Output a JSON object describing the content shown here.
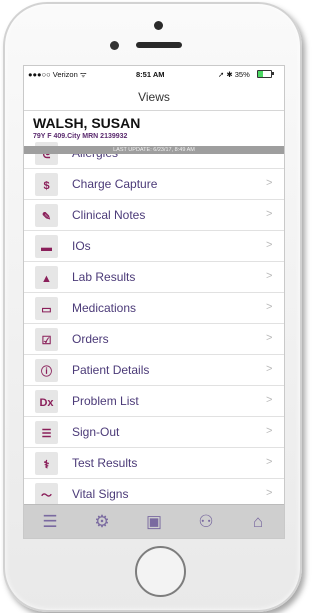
{
  "status_bar": {
    "carrier": "●●●○○ Verizon ᯤ",
    "time": "8:51 AM",
    "right": "➚ ✱ 35%",
    "battery_percent": 35
  },
  "navbar": {
    "title": "Views"
  },
  "patient": {
    "name": "WALSH, SUSAN",
    "info": "79Y F 409.City MRN 2139932",
    "last_update": "LAST UPDATE: 6/23/17, 8:49 AM"
  },
  "menu_items": [
    {
      "label": "Allergies",
      "icon": "allergies-icon",
      "glyph": "ᘓ"
    },
    {
      "label": "Charge Capture",
      "icon": "dollar-icon",
      "glyph": "$"
    },
    {
      "label": "Clinical Notes",
      "icon": "pencil-note-icon",
      "glyph": "✎"
    },
    {
      "label": "IOs",
      "icon": "container-icon",
      "glyph": "▬"
    },
    {
      "label": "Lab Results",
      "icon": "flask-icon",
      "glyph": "▲"
    },
    {
      "label": "Medications",
      "icon": "pill-icon",
      "glyph": "▭"
    },
    {
      "label": "Orders",
      "icon": "checkbox-icon",
      "glyph": "☑"
    },
    {
      "label": "Patient Details",
      "icon": "person-info-icon",
      "glyph": "ⓘ"
    },
    {
      "label": "Problem List",
      "icon": "dx-icon",
      "glyph": "Dx"
    },
    {
      "label": "Sign-Out",
      "icon": "checklist-icon",
      "glyph": "☰"
    },
    {
      "label": "Test Results",
      "icon": "ribcage-icon",
      "glyph": "⚕"
    },
    {
      "label": "Vital Signs",
      "icon": "heartbeat-icon",
      "glyph": "〜"
    }
  ],
  "chevron": ">",
  "tabbar": {
    "tabs": [
      {
        "icon": "menu-lines-icon",
        "glyph": "☰"
      },
      {
        "icon": "gear-icon",
        "glyph": "⚙"
      },
      {
        "icon": "archive-box-icon",
        "glyph": "▣"
      },
      {
        "icon": "group-icon",
        "glyph": "⚇"
      },
      {
        "icon": "home-icon",
        "glyph": "⌂"
      }
    ]
  },
  "colors": {
    "accent": "#8a1f5a",
    "label": "#4b3a78",
    "patient_info": "#5a2a6e",
    "tab_icon": "#7a6aa0",
    "battery": "#4cd964"
  }
}
